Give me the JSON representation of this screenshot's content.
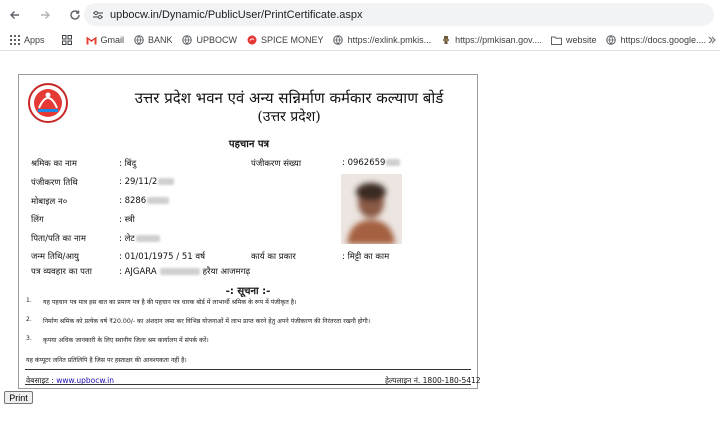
{
  "browser": {
    "url": "upbocw.in/Dynamic/PublicUser/PrintCertificate.aspx",
    "bookmarks": [
      {
        "label": "Apps",
        "icon": "apps-grid-icon"
      },
      {
        "label": "",
        "icon": "grid-icon"
      },
      {
        "label": "Gmail",
        "icon": "gmail-icon"
      },
      {
        "label": "BANK",
        "icon": "globe-icon"
      },
      {
        "label": "UPBOCW",
        "icon": "globe-icon"
      },
      {
        "label": "SPICE MONEY",
        "icon": "spice-icon"
      },
      {
        "label": "https://exlink.pmkis...",
        "icon": "globe-icon"
      },
      {
        "label": "https://pmkisan.gov....",
        "icon": "emblem-icon"
      },
      {
        "label": "website",
        "icon": "folder-icon"
      },
      {
        "label": "https://docs.google....",
        "icon": "globe-icon"
      }
    ]
  },
  "certificate": {
    "title_line1": "उत्तर प्रदेश भवन एवं अन्य सन्निर्माण कर्मकार कल्याण बोर्ड",
    "title_line2": "(उत्तर प्रदेश)",
    "id_title": "पहचान पत्र",
    "fields": {
      "name_label": "श्रमिक का नाम",
      "name_value": ": बिंदु",
      "regno_label": "पंजीकरण संख्या",
      "regno_value": ": 0962659",
      "regdate_label": "पंजीकरण तिथि",
      "regdate_value": ": 29/11/2",
      "mobile_label": "मोबाइल न०",
      "mobile_value": ": 8286",
      "gender_label": "लिंग",
      "gender_value": ": स्त्री",
      "father_label": "पिता/पति का नाम",
      "father_value": ": लेट",
      "dob_label": "जन्म तिथि/आयु",
      "dob_value": ": 01/01/1975 / 51 वर्ष",
      "work_label": "कार्य का प्रकार",
      "work_value": ": मिट्टी का काम",
      "address_label": "पत्र व्यवहार का पता",
      "address_value_prefix": ": AJGARA",
      "address_value_suffix": "हरैया आजमगढ़"
    },
    "notice_title": "-: सूचना :-",
    "notices": [
      {
        "num": "1.",
        "text": "यह पहचान पत्र मात्र इस बात का प्रमाण पत्र है की पहचान पत्र धारक बोर्ड में लाभार्थी श्रमिक के रूप में पंजीकृत है।"
      },
      {
        "num": "2.",
        "text": "निर्माण श्रमिक को प्रत्येक वर्ष ₹20.00/- का अंशदान जमा कर विभिन्न योजनाओं में लाभ प्राप्त करने हेतु अपने पंजीकरण की निरंतरता रखनी होगी।"
      },
      {
        "num": "3.",
        "text": "कृपया अधिक जानकारी के लिए स्थानीय जिला श्रम कार्यालय में संपर्क करें।"
      }
    ],
    "computer_note": "यह कंप्यूटर जनित प्रतिलिपि है जिस पर हस्ताक्षर की आवश्यकता नहीं है।",
    "website_label": "वेबसाइट :",
    "website_link": "www.upbocw.in",
    "helpline": "हेल्पलाइन नं. 1800-180-5412"
  },
  "print_button": "Print"
}
